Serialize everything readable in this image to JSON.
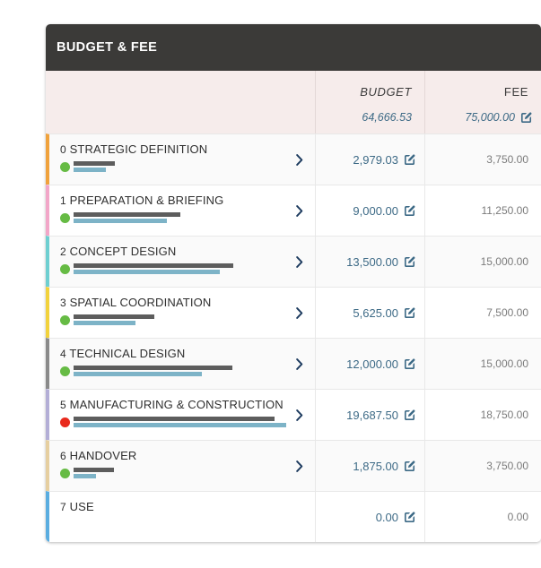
{
  "panel": {
    "title": "BUDGET & FEE",
    "header_bg": "#3b3a38"
  },
  "columns": {
    "budget": {
      "label": "BUDGET",
      "total": "64,666.53"
    },
    "fee": {
      "label": "FEE",
      "total": "75,000.00"
    }
  },
  "icons": {
    "edit": "edit-square-pencil-icon",
    "chevron": "chevron-right-icon"
  },
  "colors": {
    "budget_text": "#3d6a86",
    "fee_text": "#7b7b7b",
    "bar_gray": "#5d5d5d",
    "bar_blue": "#7db3c7",
    "status_ok": "#66bb44",
    "status_alert": "#e8291c",
    "header_band": "#f6eceb",
    "scrollbar": "#a8a8a8"
  },
  "rows": [
    {
      "num": "0",
      "name": "STRATEGIC DEFINITION",
      "accent": "#f0a23c",
      "status": "#66bb44",
      "status_name": "green",
      "bar_gray": 46,
      "bar_blue": 36,
      "budget": "2,979.03",
      "fee": "3,750.00",
      "has_chevron": true,
      "has_bars": true
    },
    {
      "num": "1",
      "name": "PREPARATION & BRIEFING",
      "accent": "#f2a6c8",
      "status": "#66bb44",
      "status_name": "green",
      "bar_gray": 119,
      "bar_blue": 104,
      "budget": "9,000.00",
      "fee": "11,250.00",
      "has_chevron": true,
      "has_bars": true
    },
    {
      "num": "2",
      "name": "CONCEPT DESIGN",
      "accent": "#6ecfd1",
      "status": "#66bb44",
      "status_name": "green",
      "bar_gray": 178,
      "bar_blue": 163,
      "budget": "13,500.00",
      "fee": "15,000.00",
      "has_chevron": true,
      "has_bars": true
    },
    {
      "num": "3",
      "name": "SPATIAL COORDINATION",
      "accent": "#f2d23c",
      "status": "#66bb44",
      "status_name": "green",
      "bar_gray": 90,
      "bar_blue": 69,
      "budget": "5,625.00",
      "fee": "7,500.00",
      "has_chevron": true,
      "has_bars": true
    },
    {
      "num": "4",
      "name": "TECHNICAL DESIGN",
      "accent": "#8a8a8a",
      "status": "#66bb44",
      "status_name": "green",
      "bar_gray": 177,
      "bar_blue": 143,
      "budget": "12,000.00",
      "fee": "15,000.00",
      "has_chevron": true,
      "has_bars": true
    },
    {
      "num": "5",
      "name": "MANUFACTURING & CONSTRUCTION",
      "accent": "#b3aed6",
      "status": "#e8291c",
      "status_name": "red",
      "bar_gray": 224,
      "bar_blue": 237,
      "budget": "19,687.50",
      "fee": "18,750.00",
      "has_chevron": true,
      "has_bars": true
    },
    {
      "num": "6",
      "name": "HANDOVER",
      "accent": "#e6cfa0",
      "status": "#66bb44",
      "status_name": "green",
      "bar_gray": 45,
      "bar_blue": 25,
      "budget": "1,875.00",
      "fee": "3,750.00",
      "has_chevron": true,
      "has_bars": true
    },
    {
      "num": "7",
      "name": "USE",
      "accent": "#5aade0",
      "status": null,
      "status_name": null,
      "bar_gray": 0,
      "bar_blue": 0,
      "budget": "0.00",
      "fee": "0.00",
      "has_chevron": false,
      "has_bars": false
    }
  ]
}
